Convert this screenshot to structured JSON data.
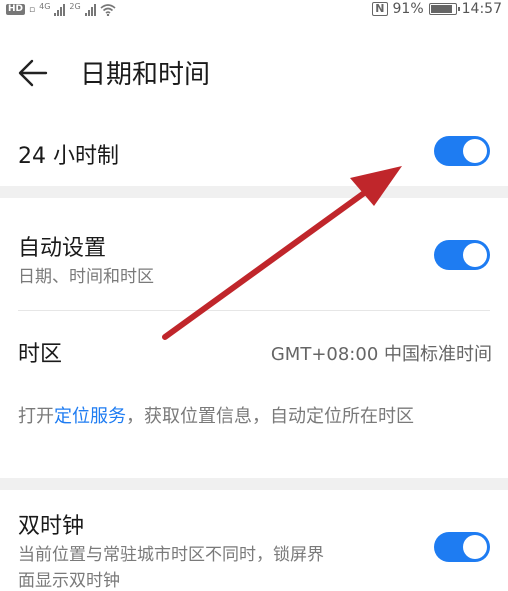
{
  "status_bar": {
    "hd_label": "HD",
    "signal1_label": "4G",
    "signal2_label": "2G",
    "battery_percent_text": "91%",
    "battery_level": 0.91,
    "time": "14:57"
  },
  "header": {
    "title": "日期和时间"
  },
  "settings": {
    "hour24": {
      "label": "24 小时制",
      "enabled": true
    },
    "auto": {
      "label": "自动设置",
      "sublabel": "日期、时间和时区",
      "enabled": true
    },
    "timezone": {
      "label": "时区",
      "value": "GMT+08:00 中国标准时间"
    },
    "hint": {
      "prefix": "打开",
      "link": "定位服务",
      "suffix": "，获取位置信息，自动定位所在时区"
    },
    "dual_clock": {
      "label": "双时钟",
      "sublabel_line1": "当前位置与常驻城市时区不同时，锁屏界",
      "sublabel_line2": "面显示双时钟",
      "enabled": true
    }
  },
  "colors": {
    "accent": "#1e7cf2",
    "arrow": "#c0262b",
    "separator": "#f0f0f0"
  },
  "icons": {
    "back": "arrow-left-icon",
    "nfc": "nfc-icon",
    "wifi": "wifi-icon",
    "battery": "battery-icon"
  }
}
